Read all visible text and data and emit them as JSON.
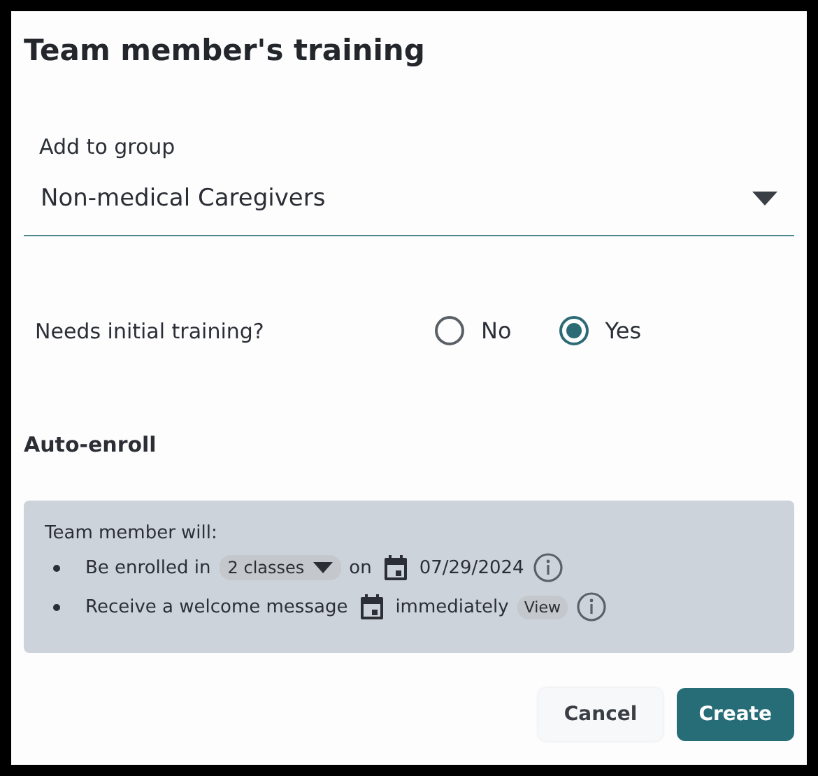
{
  "title": "Team member's training",
  "group": {
    "label": "Add to group",
    "value": "Non-medical Caregivers"
  },
  "initial_training": {
    "label": "Needs initial training?",
    "options": [
      {
        "label": "No",
        "selected": false
      },
      {
        "label": "Yes",
        "selected": true
      }
    ]
  },
  "auto_enroll": {
    "heading": "Auto-enroll",
    "intro": "Team member will:",
    "items": [
      {
        "kind": "enroll",
        "text": "Be enrolled in",
        "dropdown": "2 classes",
        "connector": "on",
        "date": "07/29/2024"
      },
      {
        "kind": "message",
        "text": "Receive a welcome message",
        "timing": "immediately",
        "link": "View"
      }
    ]
  },
  "buttons": [
    {
      "label": "Cancel",
      "kind": "secondary"
    },
    {
      "label": "Create",
      "kind": "primary"
    }
  ]
}
